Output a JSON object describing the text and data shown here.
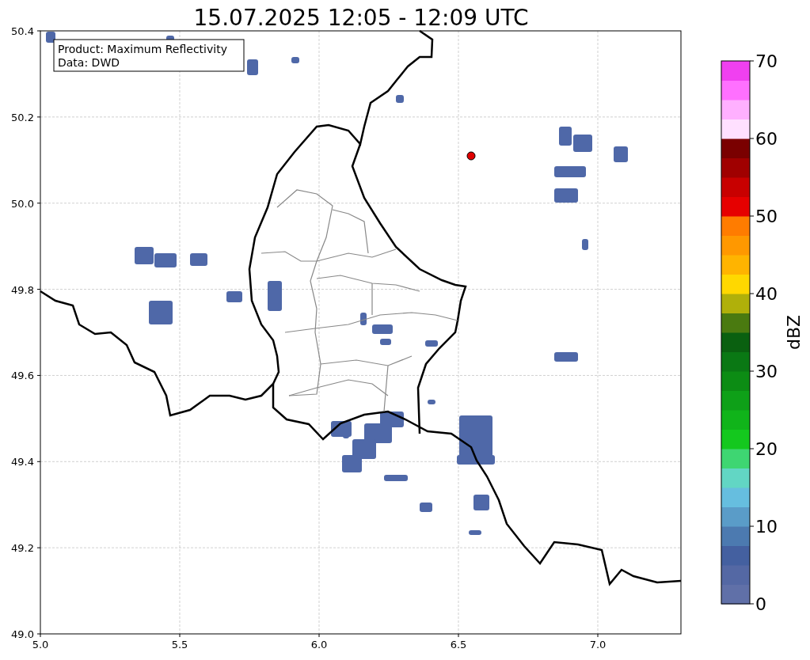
{
  "title": "15.07.2025 12:05 - 12:09 UTC",
  "map": {
    "x_ticks": [
      "5.0",
      "5.5",
      "6.0",
      "6.5",
      "7.0"
    ],
    "y_ticks": [
      "50.4",
      "50.2",
      "50.0",
      "49.8",
      "49.6",
      "49.4",
      "49.2",
      "49.0"
    ],
    "legend": {
      "lines": [
        "Product: Maximum Reflectivity",
        "Data: DWD"
      ]
    }
  },
  "colorbar": {
    "label": "dBZ",
    "ticks": [
      "70",
      "60",
      "50",
      "40",
      "30",
      "20",
      "10",
      "0"
    ],
    "bins": [
      {
        "color": "#6070a8"
      },
      {
        "color": "#5468a4"
      },
      {
        "color": "#4460a0"
      },
      {
        "color": "#4c7ab0"
      },
      {
        "color": "#5a9cc8"
      },
      {
        "color": "#66bedf"
      },
      {
        "color": "#62d6c4"
      },
      {
        "color": "#3ed672"
      },
      {
        "color": "#14c81e"
      },
      {
        "color": "#10b41a"
      },
      {
        "color": "#0ea018"
      },
      {
        "color": "#0c8c14"
      },
      {
        "color": "#0a7814"
      },
      {
        "color": "#0a6010"
      },
      {
        "color": "#4a7a10"
      },
      {
        "color": "#b0b00a"
      },
      {
        "color": "#ffd800"
      },
      {
        "color": "#ffb400"
      },
      {
        "color": "#ff9800"
      },
      {
        "color": "#ff7c00"
      },
      {
        "color": "#e60000"
      },
      {
        "color": "#c80000"
      },
      {
        "color": "#a00000"
      },
      {
        "color": "#7a0000"
      },
      {
        "color": "#ffe0ff"
      },
      {
        "color": "#ffb0ff"
      },
      {
        "color": "#ff70ff"
      },
      {
        "color": "#f040f0"
      }
    ]
  }
}
